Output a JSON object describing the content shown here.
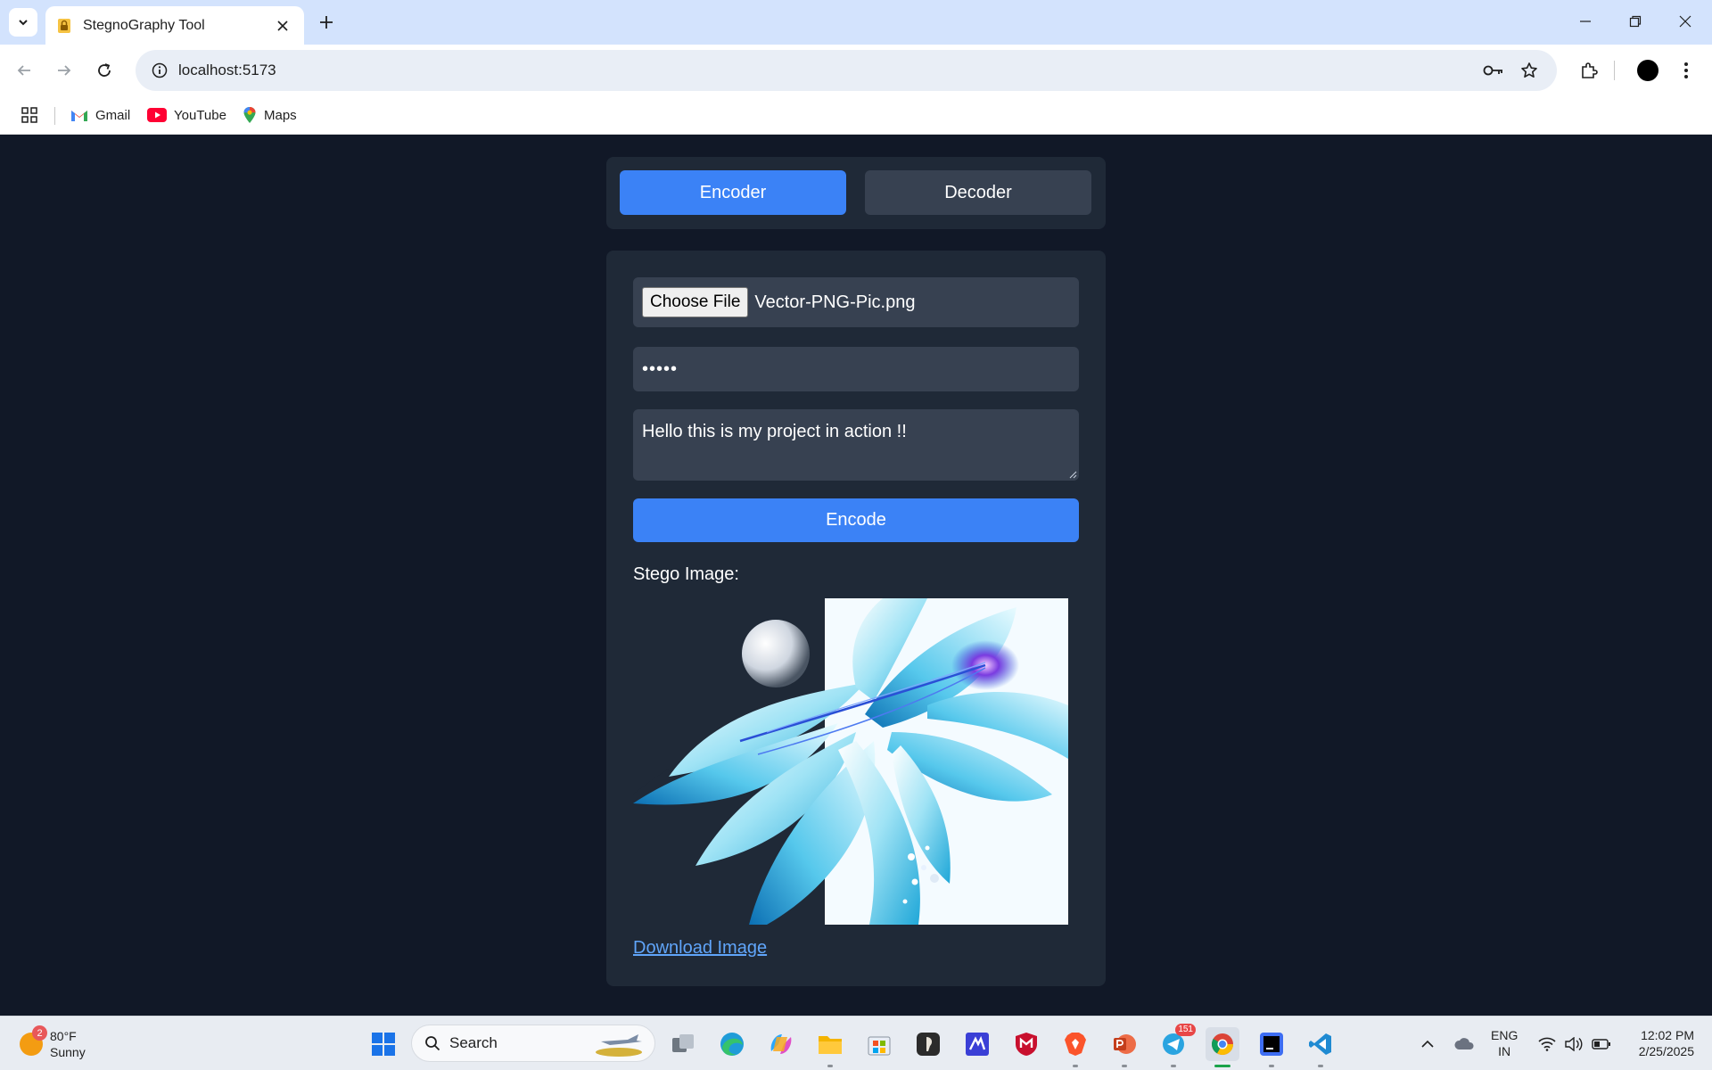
{
  "browser": {
    "tab_title": "StegnoGraphy Tool",
    "url": "localhost:5173",
    "bookmarks": [
      {
        "label": "Gmail",
        "icon": "gmail-icon"
      },
      {
        "label": "YouTube",
        "icon": "youtube-icon"
      },
      {
        "label": "Maps",
        "icon": "maps-icon"
      }
    ]
  },
  "app": {
    "mode_tabs": {
      "encoder": "Encoder",
      "decoder": "Decoder",
      "active": "Encoder"
    },
    "file_input": {
      "button_label": "Choose File",
      "file_name": "Vector-PNG-Pic.png"
    },
    "password_field": {
      "masked_value": "•••••"
    },
    "message_field": {
      "value": "Hello this is my project in action !!"
    },
    "encode_button": "Encode",
    "result": {
      "label": "Stego Image:",
      "download_link": "Download Image"
    },
    "colors": {
      "background": "#111827",
      "card": "#1f2937",
      "field": "#374151",
      "accent": "#3b82f6",
      "link": "#60a5fa"
    }
  },
  "taskbar": {
    "weather": {
      "badge": "2",
      "temp": "80°F",
      "condition": "Sunny"
    },
    "search_label": "Search",
    "telegram_badge": "151",
    "language": {
      "line1": "ENG",
      "line2": "IN"
    },
    "clock": {
      "time": "12:02 PM",
      "date": "2/25/2025"
    }
  }
}
